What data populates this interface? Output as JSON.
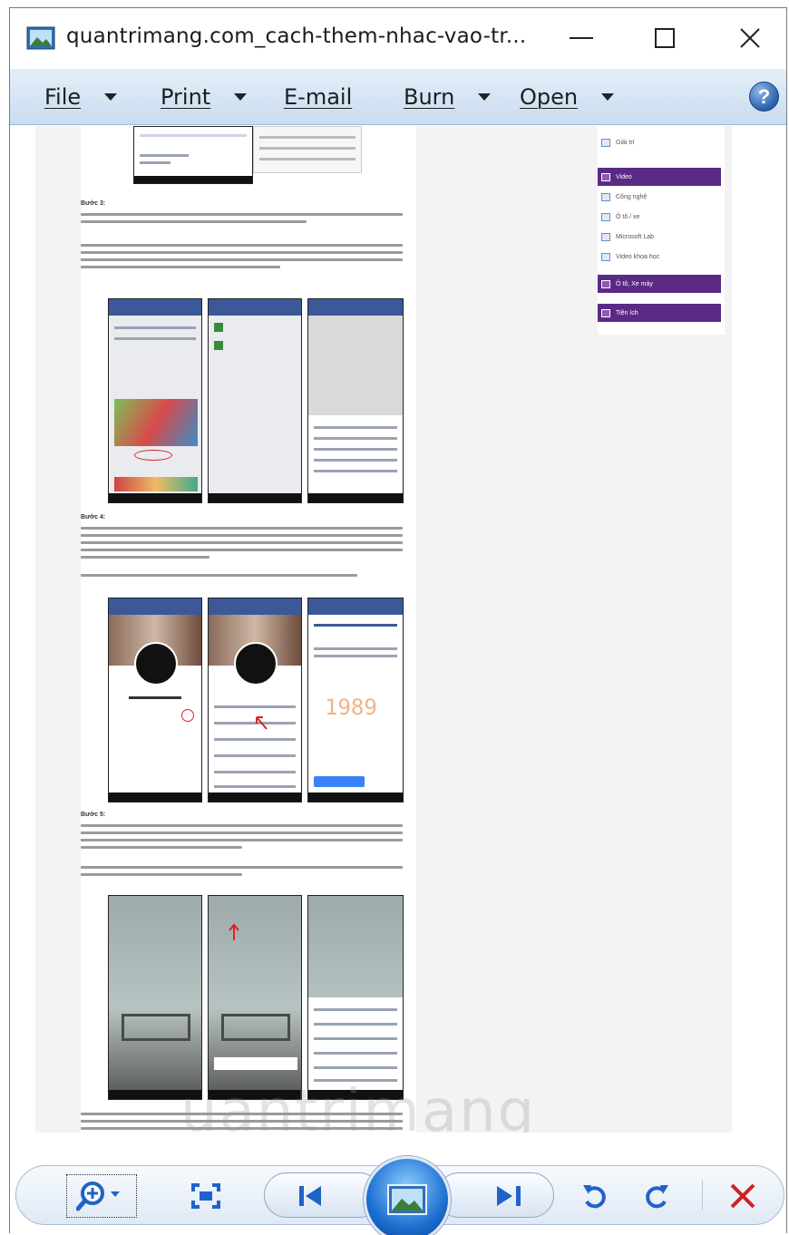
{
  "window": {
    "title": "quantrimang.com_cach-them-nhac-vao-tr..."
  },
  "menu": {
    "file": "File",
    "print": "Print",
    "email": "E-mail",
    "burn": "Burn",
    "open": "Open",
    "help": "?"
  },
  "document": {
    "step3": "Bước 3:",
    "step4": "Bước 4:",
    "step5": "Bước 5:",
    "watermark": "uantrimang",
    "sidebar": [
      {
        "label": "Giải trí",
        "highlight": false
      },
      {
        "label": "Video",
        "highlight": true
      },
      {
        "label": "Công nghệ",
        "highlight": false
      },
      {
        "label": "Ô tô / xe",
        "highlight": false
      },
      {
        "label": "Microsoft Lab",
        "highlight": false
      },
      {
        "label": "Video khoa học",
        "highlight": false
      },
      {
        "label": "Ô tô, Xe máy",
        "highlight": true
      },
      {
        "label": "Tiện ích",
        "highlight": true
      }
    ],
    "phone_text": {
      "time_big": "1989"
    }
  },
  "toolbar": {
    "zoom": "zoom",
    "fit": "actual-size",
    "previous": "previous",
    "slideshow": "slideshow",
    "next": "next",
    "rotate_ccw": "rotate-counterclockwise",
    "rotate_cw": "rotate-clockwise",
    "delete": "delete"
  },
  "colors": {
    "menubar": "#d4e3f4",
    "sidebar_purple": "#5b2a86",
    "facebook_blue": "#3b5998",
    "delete_red": "#d21f1f",
    "rotate_blue": "#1f63c8"
  }
}
